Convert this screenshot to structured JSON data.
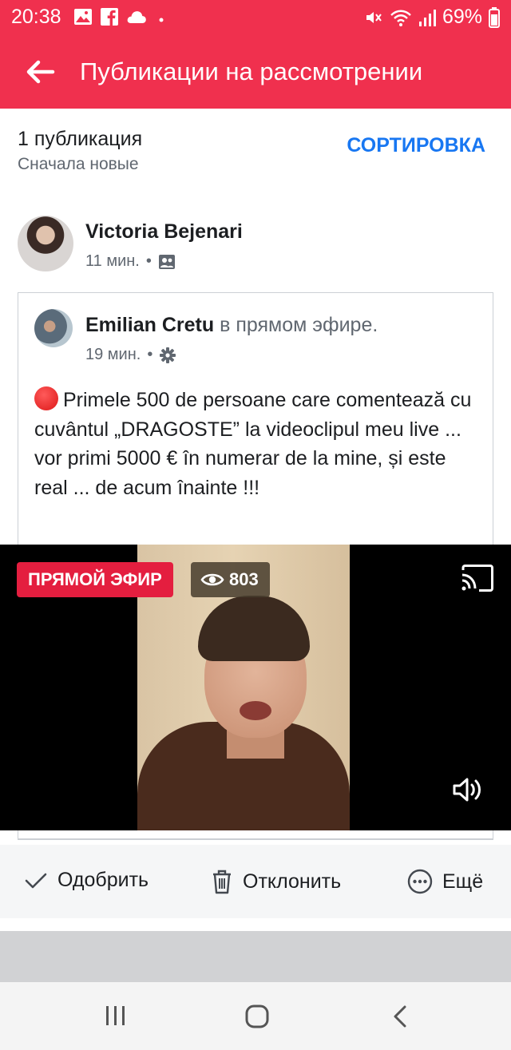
{
  "status_bar": {
    "time": "20:38",
    "battery": "69%",
    "icons": [
      "gallery-icon",
      "facebook-icon",
      "cloud-icon",
      "dot-icon",
      "mute-icon",
      "wifi-icon",
      "signal-icon",
      "battery-icon"
    ]
  },
  "app_bar": {
    "title": "Публикации на рассмотрении",
    "back_icon": "arrow-left-icon"
  },
  "list_header": {
    "count": "1 публикация",
    "order": "Сначала новые",
    "sort_label": "СОРТИРОВКА"
  },
  "post": {
    "author": "Victoria Bejenari",
    "time": "11 мин.",
    "separator": "•",
    "shared": {
      "author": "Emilian Cretu",
      "status": " в прямом эфире.",
      "time": "19 мин.",
      "separator": "•",
      "text": "Primele 500 de persoane care comentează cu cuvântul „DRAGOSTE” la videoclipul meu live ... vor primi 5000 € în numerar de la mine, și este real ... de acum înainte !!!"
    },
    "video": {
      "live_label": "ПРЯМОЙ ЭФИР",
      "views": "803"
    }
  },
  "actions": {
    "approve": "Одобрить",
    "decline": "Отклонить",
    "more": "Ещё"
  },
  "colors": {
    "brand_red": "#f0304e",
    "link_blue": "#1877f2",
    "live_red": "#e41e3f"
  }
}
